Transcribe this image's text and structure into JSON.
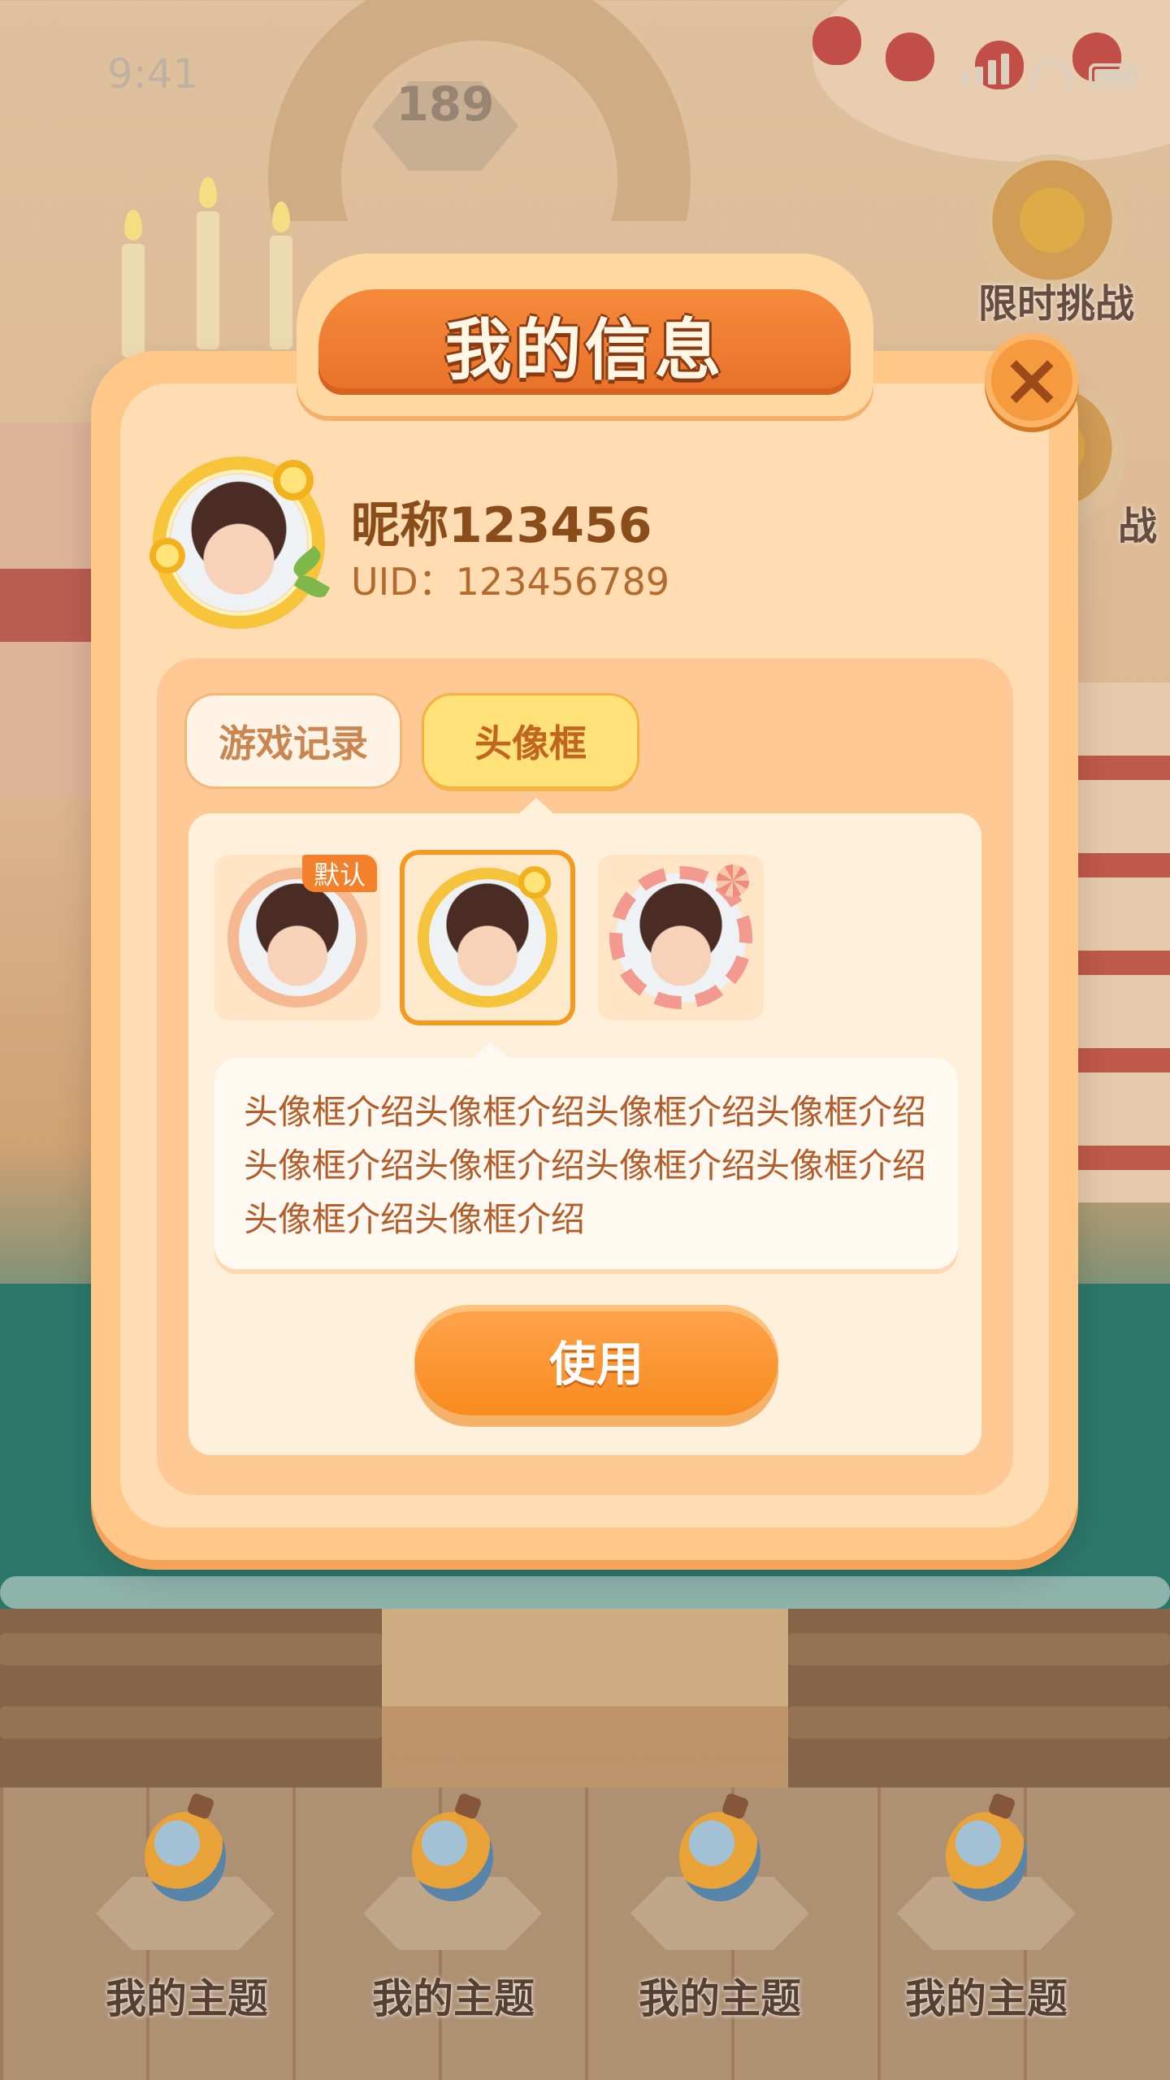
{
  "status_bar": {
    "time": "9:41"
  },
  "level": {
    "number": "189"
  },
  "side_buttons": [
    {
      "label": "限时挑战"
    },
    {
      "label": "战"
    }
  ],
  "modal": {
    "title": "我的信息",
    "close_icon": "close-icon",
    "profile": {
      "nickname": "昵称123456",
      "uid": "UID：123456789"
    },
    "tabs": [
      {
        "label": "游戏记录",
        "active": false
      },
      {
        "label": "头像框",
        "active": true
      }
    ],
    "frames": [
      {
        "name": "default",
        "badge": "默认",
        "selected": false
      },
      {
        "name": "lemon",
        "selected": true
      },
      {
        "name": "candy",
        "selected": false
      }
    ],
    "description": "头像框介绍头像框介绍头像框介绍头像框介绍头像框介绍头像框介绍头像框介绍头像框介绍头像框介绍头像框介绍",
    "use_button": "使用"
  },
  "bottom_nav": [
    {
      "label": "我的主题"
    },
    {
      "label": "我的主题"
    },
    {
      "label": "我的主题"
    },
    {
      "label": "我的主题"
    }
  ],
  "colors": {
    "accent_orange": "#f88b1e",
    "title_bar": "#e8712a",
    "modal_bg": "#ffc889",
    "text_brown": "#8a4d1a"
  }
}
